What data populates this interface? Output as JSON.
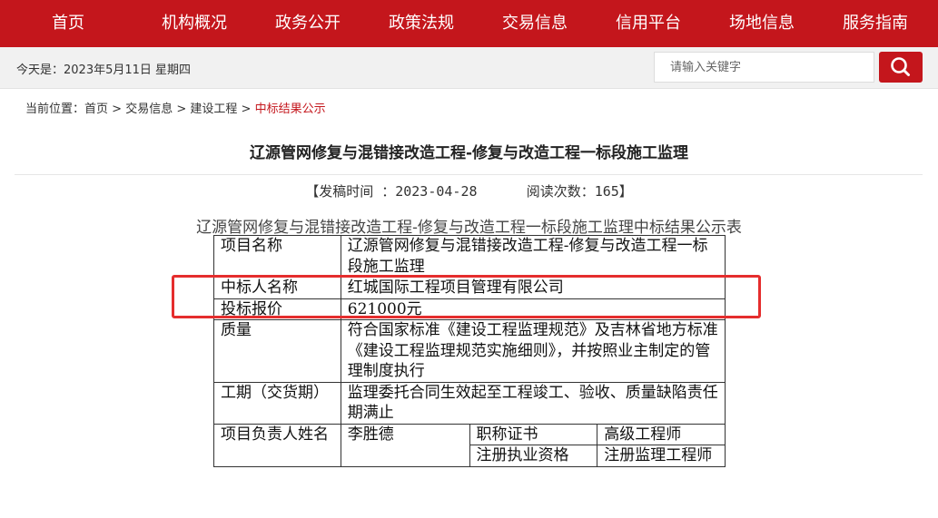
{
  "nav": {
    "items": [
      "首页",
      "机构概况",
      "政务公开",
      "政策法规",
      "交易信息",
      "信用平台",
      "场地信息",
      "服务指南"
    ]
  },
  "topbar": {
    "date_text": "今天是：2023年5月11日  星期四",
    "search_placeholder": "请输入关键字"
  },
  "breadcrumb": {
    "prefix": "当前位置：",
    "items": [
      "首页",
      "交易信息",
      "建设工程"
    ],
    "separator": " > ",
    "current": "中标结果公示"
  },
  "article": {
    "title": "辽源管网修复与混错接改造工程-修复与改造工程一标段施工监理",
    "meta": "【发稿时间 ：2023-04-28      阅读次数：165】",
    "caption": "辽源管网修复与混错接改造工程-修复与改造工程一标段施工监理中标结果公示表"
  },
  "table": {
    "project_name_label": "项目名称",
    "project_name_value": "辽源管网修复与混错接改造工程-修复与改造工程一标段施工监理",
    "winner_label": "中标人名称",
    "winner_value": "红城国际工程项目管理有限公司",
    "bid_label": "投标报价",
    "bid_value": "621000元",
    "quality_label": "质量",
    "quality_value": "符合国家标准《建设工程监理规范》及吉林省地方标准《建设工程监理规范实施细则》，并按照业主制定的管理制度执行",
    "period_label": "工期（交货期）",
    "period_value": "监理委托合同生效起至工程竣工、验收、质量缺陷责任期满止",
    "manager_label": "项目负责人姓名",
    "manager_value": "李胜德",
    "title_cert_label": "职称证书",
    "title_cert_value": "高级工程师",
    "practice_label": "注册执业资格",
    "practice_value": "注册监理工程师"
  },
  "colors": {
    "brand": "#c4161c",
    "highlight": "#e52d2d"
  }
}
